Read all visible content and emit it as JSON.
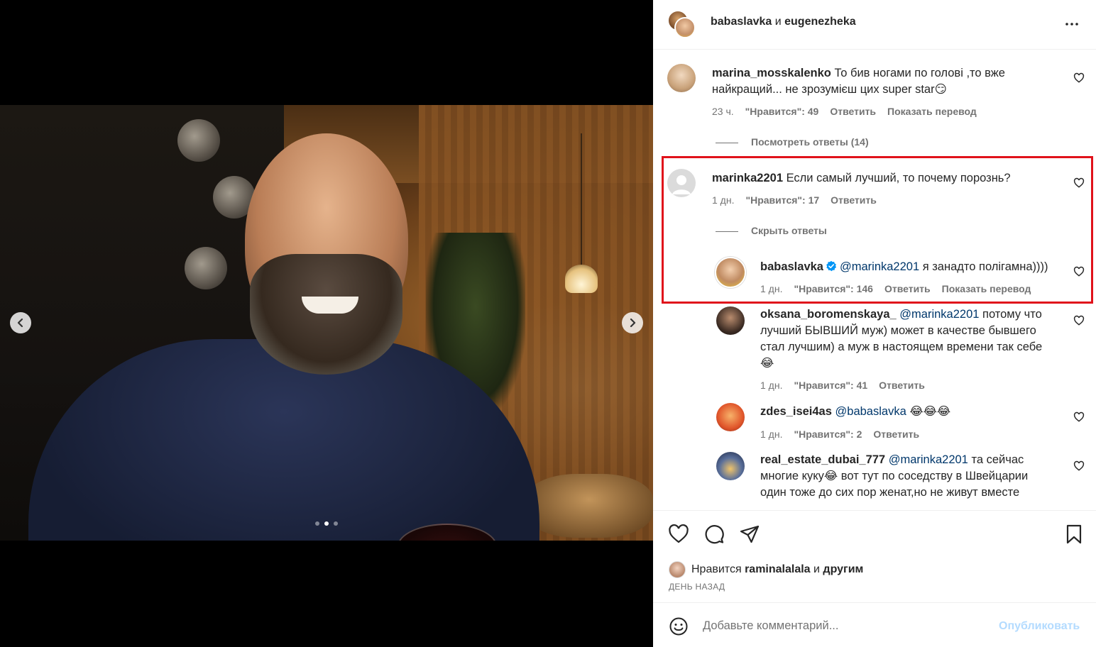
{
  "post": {
    "header": {
      "user1": "babaslavka",
      "conj": "и",
      "user2": "eugenezheka"
    },
    "carousel": {
      "slides": 3,
      "active": 2
    }
  },
  "comments": [
    {
      "user": "marina_mosskalenko",
      "text_line1": "То бив ногами по голові ,то вже",
      "text_line2": "найкращий... не зрозумієш цих super star😏",
      "time": "23 ч.",
      "likes": "\"Нравится\": 49",
      "reply": "Ответить",
      "translate": "Показать перевод",
      "replies_toggle": "Посмотреть ответы (14)"
    },
    {
      "user": "marinka2201",
      "text": "Если самый лучший, то почему порознь?",
      "time": "1 дн.",
      "likes": "\"Нравится\": 17",
      "reply": "Ответить",
      "replies_toggle": "Скрыть ответы"
    }
  ],
  "replies": [
    {
      "user": "babaslavka",
      "mention": "@marinka2201",
      "text": " я занадто полігамна))))",
      "time": "1 дн.",
      "likes": "\"Нравится\": 146",
      "reply": "Ответить",
      "translate": "Показать перевод"
    },
    {
      "user": "oksana_boromenskaya_",
      "mention": "@marinka2201",
      "text_line1": " потому что",
      "text_line2": "лучший БЫВШИЙ муж) может в качестве бывшего",
      "text_line3": "стал лучшим) а муж в настоящем времени так себе",
      "text_line4": "😂",
      "time": "1 дн.",
      "likes": "\"Нравится\": 41",
      "reply": "Ответить"
    },
    {
      "user": "zdes_isei4as",
      "mention": "@babaslavka",
      "text": " 😂😂😂",
      "time": "1 дн.",
      "likes": "\"Нравится\": 2",
      "reply": "Ответить"
    },
    {
      "user": "real_estate_dubai_777",
      "mention": "@marinka2201",
      "text_line1": " та сейчас",
      "text_line2": "многие куку😂  вот тут по соседству в Швейцарии",
      "text_line3": "один тоже до сих пор женат,но не живут вместе"
    }
  ],
  "footer": {
    "liked_prefix": "Нравится",
    "liked_user": "raminalalala",
    "liked_and": "и",
    "liked_others": "другим",
    "time_ago": "ДЕНЬ НАЗАД",
    "comment_placeholder": "Добавьте комментарий...",
    "publish": "Опубликовать"
  },
  "colors": {
    "highlight": "#e0121b",
    "mention": "#00376b",
    "verified": "#0095f6",
    "publish_disabled": "#b3dbff"
  },
  "icons": [
    "chevron-left-icon",
    "chevron-right-icon",
    "more-icon",
    "heart-icon",
    "comment-icon",
    "share-icon",
    "bookmark-icon",
    "emoji-icon",
    "verified-icon"
  ]
}
